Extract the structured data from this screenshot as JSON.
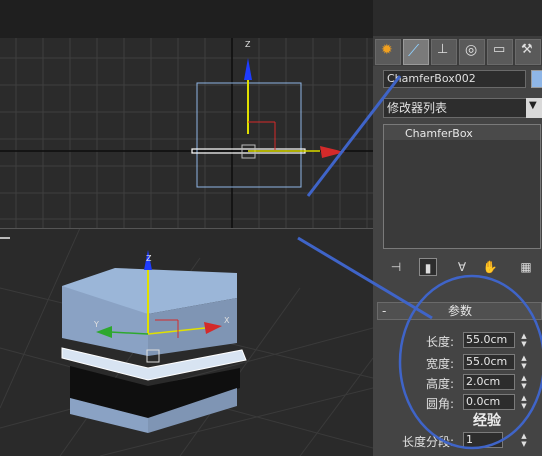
{
  "object_name": "ChamferBox002",
  "modifier_list": {
    "label": "修改器列表"
  },
  "modifier_stack": {
    "items": [
      "ChamferBox"
    ]
  },
  "parameters": {
    "rollout_title": "参数",
    "collapse_symbol": "-",
    "rows": [
      {
        "label": "长度:",
        "value": "55.0cm"
      },
      {
        "label": "宽度:",
        "value": "55.0cm"
      },
      {
        "label": "高度:",
        "value": "2.0cm"
      },
      {
        "label": "圆角:",
        "value": "0.0cm"
      },
      {
        "label": "长度分段:",
        "value": "1"
      }
    ]
  },
  "viewport_top": {
    "gizmo_axis_label": "Z"
  },
  "viewport_persp": {
    "gizmo_labels": [
      "Z",
      "X",
      "Y"
    ]
  },
  "watermark": {
    "text": "经验"
  },
  "colors": {
    "viewport_bg": "#2b2b2b",
    "grid": "#3f3f3f",
    "annotation": "#3f64c8",
    "box_top": "#9bb6d8",
    "box_side": "#7f95b4",
    "axis_x": "#d42a2a",
    "axis_y": "#2ea82e",
    "axis_z": "#1e3cff",
    "selection": "#8fb6e6"
  }
}
